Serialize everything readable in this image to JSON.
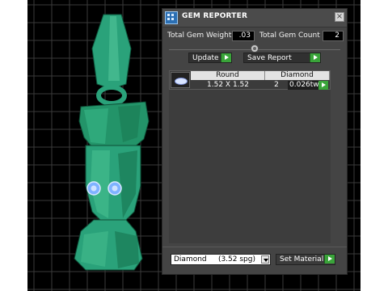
{
  "panel": {
    "title": "GEM REPORTER",
    "close_glyph": "×",
    "total_weight_label": "Total Gem Weight",
    "total_weight_value": ".03",
    "total_count_label": "Total Gem Count",
    "total_count_value": "2",
    "update_label": "Update",
    "save_report_label": "Save Report",
    "table": {
      "headers": [
        "Round",
        "Diamond"
      ],
      "rows": [
        {
          "size": "1.52 X 1.52",
          "count": "2",
          "weight": "0.026tw"
        }
      ]
    },
    "material_select": "Diamond     (3.52 spg)",
    "set_material_label": "Set Material"
  },
  "colors": {
    "model_green": "#2aa27a",
    "eye_blue": "#7fb2ff",
    "play_green": "#3aa43a"
  }
}
